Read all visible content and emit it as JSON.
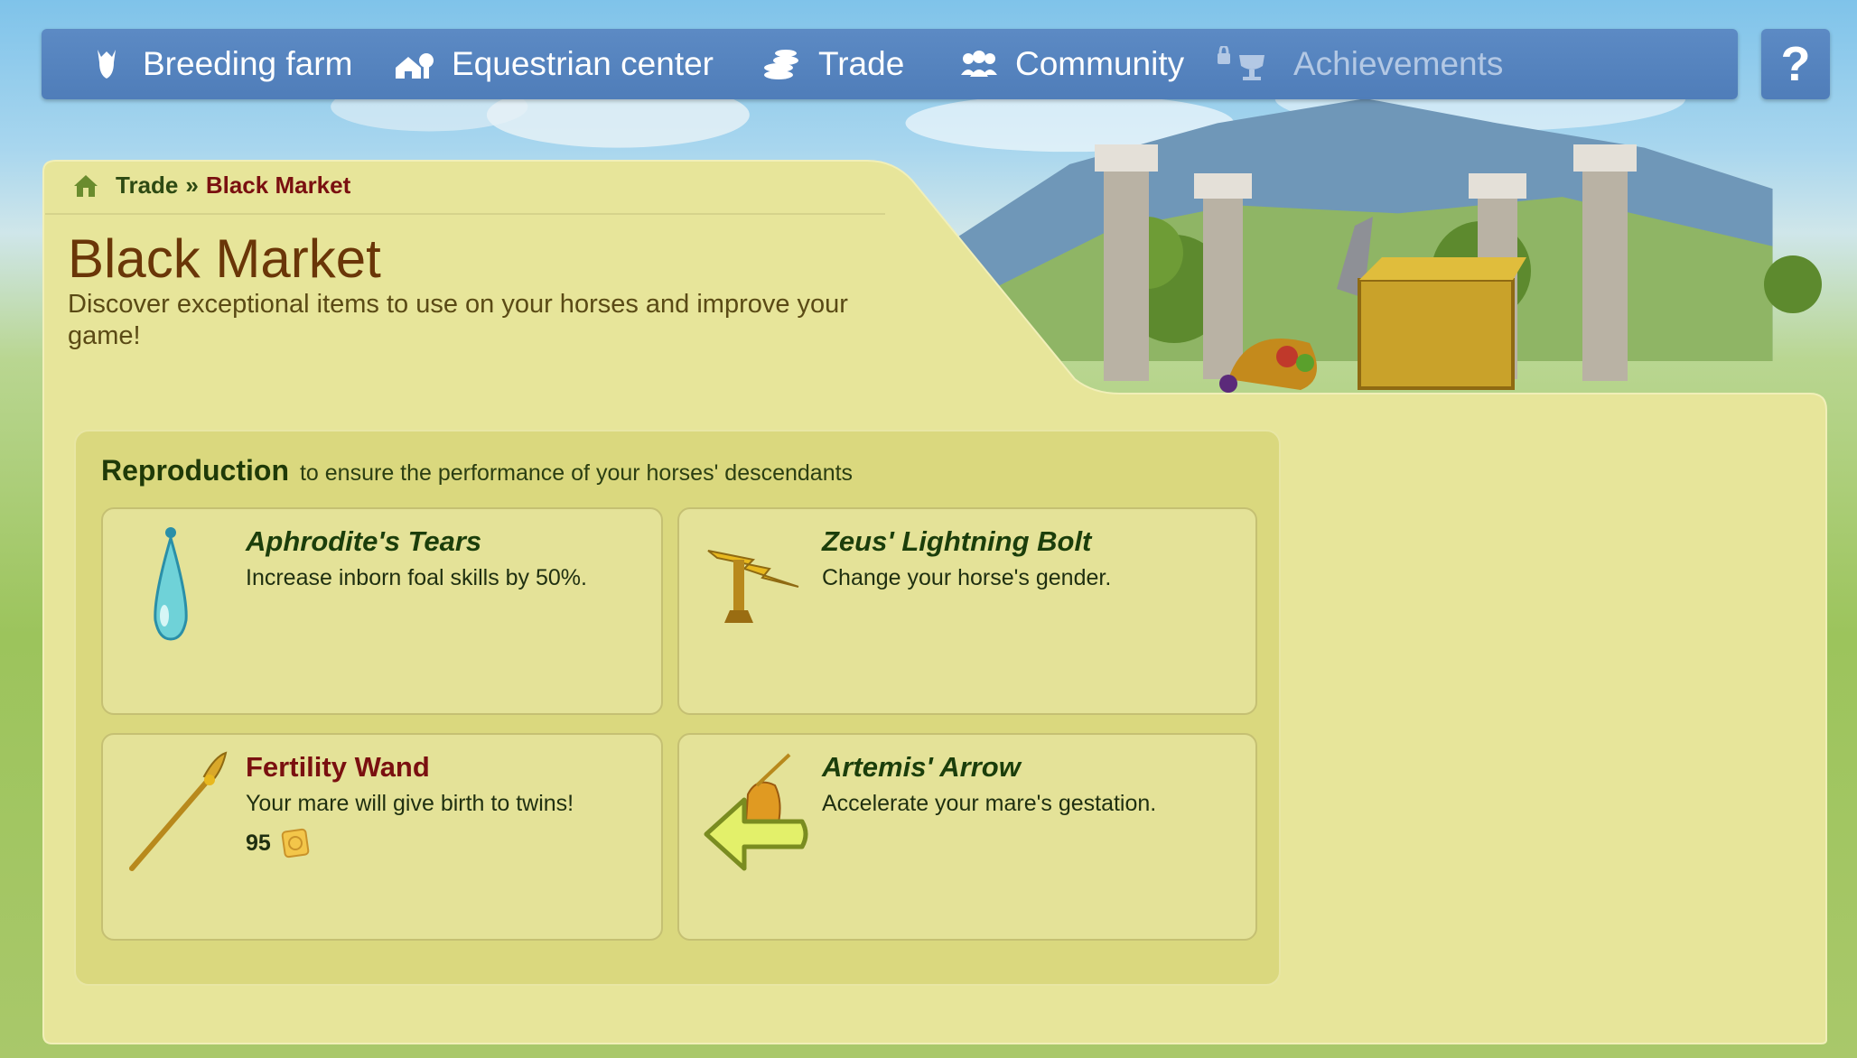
{
  "nav": {
    "items": [
      {
        "label": "Breeding farm",
        "icon": "horse-head-icon"
      },
      {
        "label": "Equestrian center",
        "icon": "stable-icon"
      },
      {
        "label": "Trade",
        "icon": "coins-stack-icon"
      },
      {
        "label": "Community",
        "icon": "community-icon"
      },
      {
        "label": "Achievements",
        "icon": "trophy-locked-icon",
        "disabled": true
      }
    ],
    "help_label": "?"
  },
  "breadcrumb": {
    "parent": "Trade",
    "separator": "»",
    "current": "Black Market"
  },
  "page": {
    "title": "Black Market",
    "subtitle": "Discover exceptional items to use on your horses and improve your game!"
  },
  "section": {
    "title": "Reproduction",
    "subtitle": "to ensure the performance of your horses' descendants",
    "items": [
      {
        "name": "Aphrodite's Tears",
        "description": "Increase inborn foal skills by 50%.",
        "icon": "potion-drop-icon"
      },
      {
        "name": "Zeus' Lightning Bolt",
        "description": "Change your horse's gender.",
        "icon": "lightning-bolt-icon"
      },
      {
        "name": "Fertility Wand",
        "description": "Your mare will give birth to twins!",
        "price": "95",
        "icon": "wand-icon",
        "price_icon": "pass-coin-icon"
      },
      {
        "name": "Artemis' Arrow",
        "description": "Accelerate your mare's gestation.",
        "icon": "arrow-icon"
      }
    ]
  },
  "colors": {
    "nav": "#5583bf",
    "panel": "#e7e59a",
    "title": "#6a3608",
    "item_title": "#1b3e0b",
    "item_title_highlight": "#7a1010"
  }
}
